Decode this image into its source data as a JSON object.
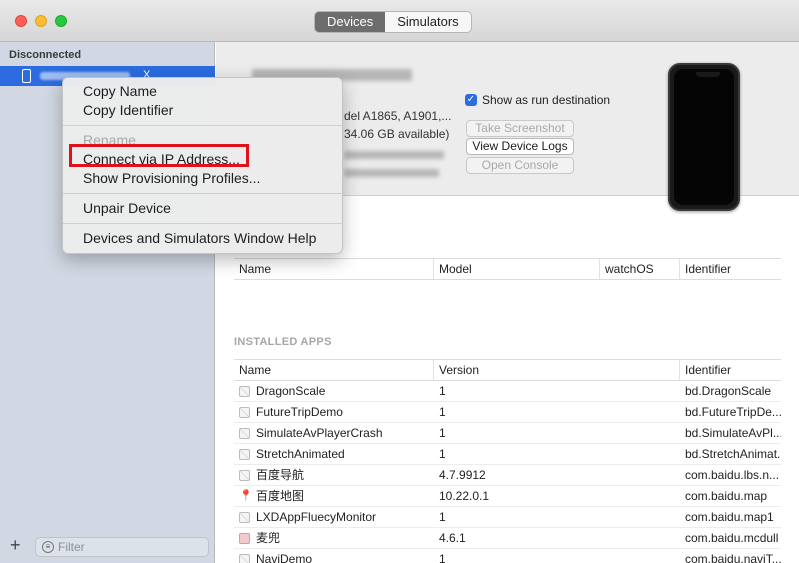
{
  "titlebar": {
    "tabs": [
      {
        "label": "Devices",
        "active": true
      },
      {
        "label": "Simulators",
        "active": false
      }
    ]
  },
  "sidebar": {
    "section_header": "Disconnected",
    "filter_placeholder": "Filter",
    "add_label": "+",
    "selected_suffix": "X"
  },
  "device": {
    "model_line": "del A1865, A1901,...",
    "capacity_line": "34.06 GB available)",
    "show_as_run_destination": "Show as run destination",
    "buttons": {
      "take_screenshot": "Take Screenshot",
      "view_device_logs": "View Device Logs",
      "open_console": "Open Console"
    }
  },
  "paired_table": {
    "columns": [
      "Name",
      "Model",
      "watchOS",
      "Identifier"
    ]
  },
  "installed_apps": {
    "title": "INSTALLED APPS",
    "columns": [
      "Name",
      "Version",
      "Identifier"
    ],
    "rows": [
      {
        "name": "DragonScale",
        "version": "1",
        "identifier": "bd.DragonScale",
        "icon": "placeholder-icon"
      },
      {
        "name": "FutureTripDemo",
        "version": "1",
        "identifier": "bd.FutureTripDe...",
        "icon": "placeholder-icon"
      },
      {
        "name": "SimulateAvPlayerCrash",
        "version": "1",
        "identifier": "bd.SimulateAvPl...",
        "icon": "placeholder-icon"
      },
      {
        "name": "StretchAnimated",
        "version": "1",
        "identifier": "bd.StretchAnimat...",
        "icon": "placeholder-icon"
      },
      {
        "name": "百度导航",
        "version": "4.7.9912",
        "identifier": "com.baidu.lbs.n...",
        "icon": "placeholder-icon"
      },
      {
        "name": "百度地图",
        "version": "10.22.0.1",
        "identifier": "com.baidu.map",
        "icon": "map-pin-icon"
      },
      {
        "name": "LXDAppFluecyMonitor",
        "version": "1",
        "identifier": "com.baidu.map1",
        "icon": "placeholder-icon"
      },
      {
        "name": "麦兜",
        "version": "4.6.1",
        "identifier": "com.baidu.mcdull",
        "icon": "mascot-icon"
      },
      {
        "name": "NaviDemo",
        "version": "1",
        "identifier": "com.baidu.naviT...",
        "icon": "placeholder-icon"
      }
    ]
  },
  "context_menu": {
    "items": {
      "copy_name": "Copy Name",
      "copy_identifier": "Copy Identifier",
      "rename": "Rename",
      "connect_ip": "Connect via IP Address...",
      "show_profiles": "Show Provisioning Profiles...",
      "unpair": "Unpair Device",
      "help": "Devices and Simulators Window Help"
    }
  },
  "colors": {
    "accent": "#2c6ce0",
    "highlight_box": "#e0111b",
    "sidebar_bg": "#d2d8e3"
  }
}
